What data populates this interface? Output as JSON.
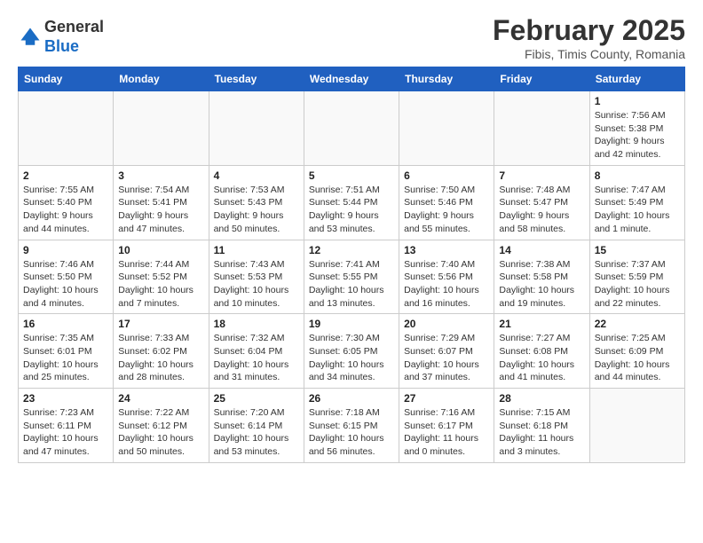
{
  "logo": {
    "general": "General",
    "blue": "Blue"
  },
  "title": "February 2025",
  "subtitle": "Fibis, Timis County, Romania",
  "weekdays": [
    "Sunday",
    "Monday",
    "Tuesday",
    "Wednesday",
    "Thursday",
    "Friday",
    "Saturday"
  ],
  "weeks": [
    [
      {
        "day": "",
        "info": ""
      },
      {
        "day": "",
        "info": ""
      },
      {
        "day": "",
        "info": ""
      },
      {
        "day": "",
        "info": ""
      },
      {
        "day": "",
        "info": ""
      },
      {
        "day": "",
        "info": ""
      },
      {
        "day": "1",
        "info": "Sunrise: 7:56 AM\nSunset: 5:38 PM\nDaylight: 9 hours and 42 minutes."
      }
    ],
    [
      {
        "day": "2",
        "info": "Sunrise: 7:55 AM\nSunset: 5:40 PM\nDaylight: 9 hours and 44 minutes."
      },
      {
        "day": "3",
        "info": "Sunrise: 7:54 AM\nSunset: 5:41 PM\nDaylight: 9 hours and 47 minutes."
      },
      {
        "day": "4",
        "info": "Sunrise: 7:53 AM\nSunset: 5:43 PM\nDaylight: 9 hours and 50 minutes."
      },
      {
        "day": "5",
        "info": "Sunrise: 7:51 AM\nSunset: 5:44 PM\nDaylight: 9 hours and 53 minutes."
      },
      {
        "day": "6",
        "info": "Sunrise: 7:50 AM\nSunset: 5:46 PM\nDaylight: 9 hours and 55 minutes."
      },
      {
        "day": "7",
        "info": "Sunrise: 7:48 AM\nSunset: 5:47 PM\nDaylight: 9 hours and 58 minutes."
      },
      {
        "day": "8",
        "info": "Sunrise: 7:47 AM\nSunset: 5:49 PM\nDaylight: 10 hours and 1 minute."
      }
    ],
    [
      {
        "day": "9",
        "info": "Sunrise: 7:46 AM\nSunset: 5:50 PM\nDaylight: 10 hours and 4 minutes."
      },
      {
        "day": "10",
        "info": "Sunrise: 7:44 AM\nSunset: 5:52 PM\nDaylight: 10 hours and 7 minutes."
      },
      {
        "day": "11",
        "info": "Sunrise: 7:43 AM\nSunset: 5:53 PM\nDaylight: 10 hours and 10 minutes."
      },
      {
        "day": "12",
        "info": "Sunrise: 7:41 AM\nSunset: 5:55 PM\nDaylight: 10 hours and 13 minutes."
      },
      {
        "day": "13",
        "info": "Sunrise: 7:40 AM\nSunset: 5:56 PM\nDaylight: 10 hours and 16 minutes."
      },
      {
        "day": "14",
        "info": "Sunrise: 7:38 AM\nSunset: 5:58 PM\nDaylight: 10 hours and 19 minutes."
      },
      {
        "day": "15",
        "info": "Sunrise: 7:37 AM\nSunset: 5:59 PM\nDaylight: 10 hours and 22 minutes."
      }
    ],
    [
      {
        "day": "16",
        "info": "Sunrise: 7:35 AM\nSunset: 6:01 PM\nDaylight: 10 hours and 25 minutes."
      },
      {
        "day": "17",
        "info": "Sunrise: 7:33 AM\nSunset: 6:02 PM\nDaylight: 10 hours and 28 minutes."
      },
      {
        "day": "18",
        "info": "Sunrise: 7:32 AM\nSunset: 6:04 PM\nDaylight: 10 hours and 31 minutes."
      },
      {
        "day": "19",
        "info": "Sunrise: 7:30 AM\nSunset: 6:05 PM\nDaylight: 10 hours and 34 minutes."
      },
      {
        "day": "20",
        "info": "Sunrise: 7:29 AM\nSunset: 6:07 PM\nDaylight: 10 hours and 37 minutes."
      },
      {
        "day": "21",
        "info": "Sunrise: 7:27 AM\nSunset: 6:08 PM\nDaylight: 10 hours and 41 minutes."
      },
      {
        "day": "22",
        "info": "Sunrise: 7:25 AM\nSunset: 6:09 PM\nDaylight: 10 hours and 44 minutes."
      }
    ],
    [
      {
        "day": "23",
        "info": "Sunrise: 7:23 AM\nSunset: 6:11 PM\nDaylight: 10 hours and 47 minutes."
      },
      {
        "day": "24",
        "info": "Sunrise: 7:22 AM\nSunset: 6:12 PM\nDaylight: 10 hours and 50 minutes."
      },
      {
        "day": "25",
        "info": "Sunrise: 7:20 AM\nSunset: 6:14 PM\nDaylight: 10 hours and 53 minutes."
      },
      {
        "day": "26",
        "info": "Sunrise: 7:18 AM\nSunset: 6:15 PM\nDaylight: 10 hours and 56 minutes."
      },
      {
        "day": "27",
        "info": "Sunrise: 7:16 AM\nSunset: 6:17 PM\nDaylight: 11 hours and 0 minutes."
      },
      {
        "day": "28",
        "info": "Sunrise: 7:15 AM\nSunset: 6:18 PM\nDaylight: 11 hours and 3 minutes."
      },
      {
        "day": "",
        "info": ""
      }
    ]
  ]
}
